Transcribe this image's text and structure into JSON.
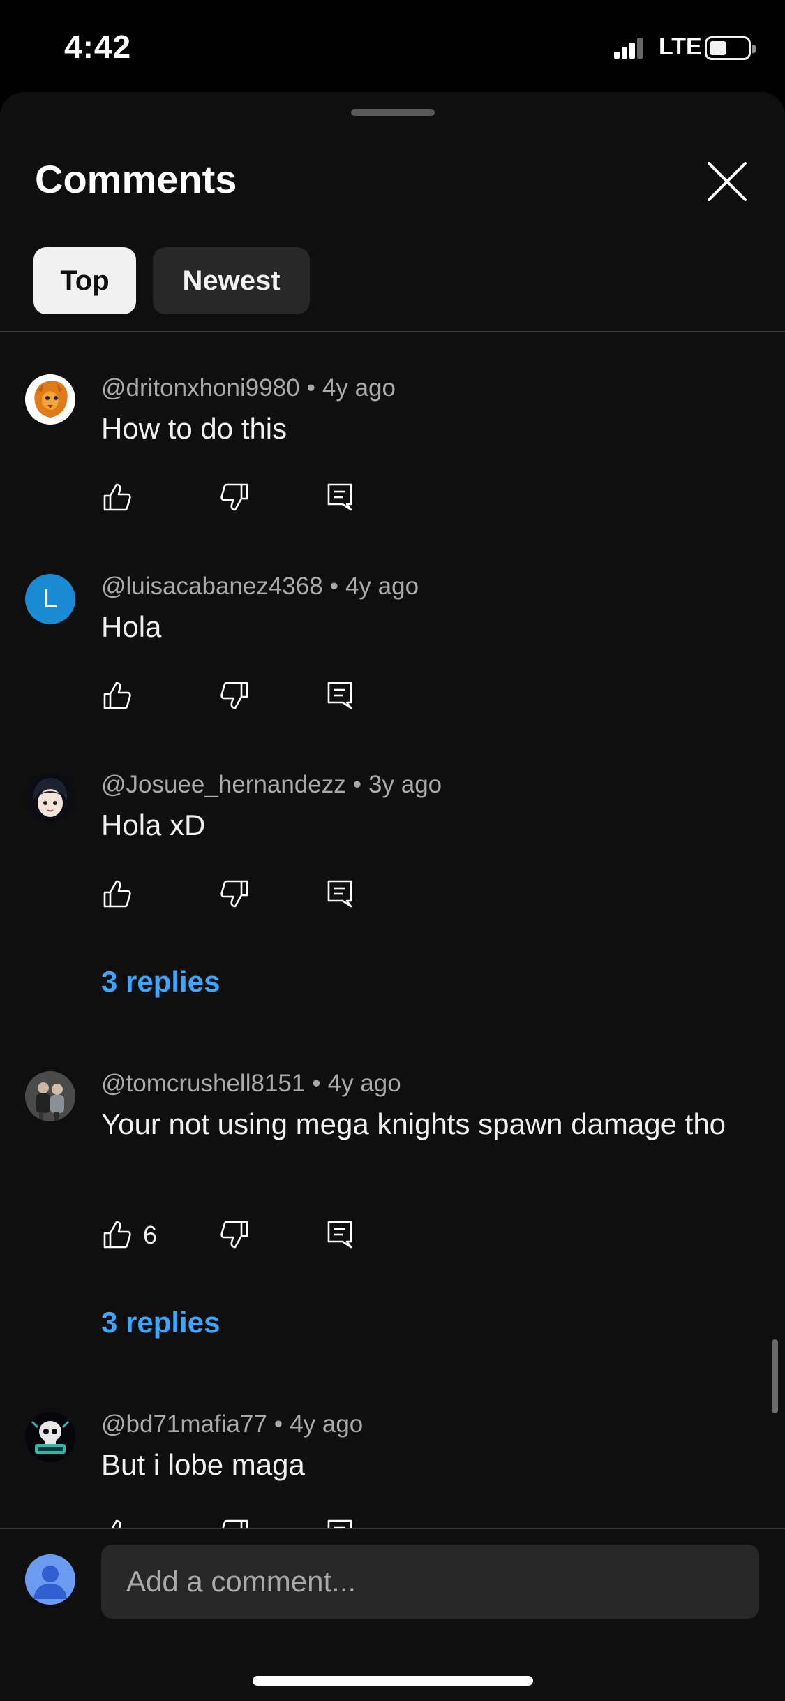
{
  "status_bar": {
    "time": "4:42",
    "network": "LTE",
    "icons": [
      "signal-icon",
      "battery-icon"
    ]
  },
  "sheet": {
    "title": "Comments",
    "close_icon": "close-icon",
    "filters": [
      {
        "label": "Top",
        "selected": true
      },
      {
        "label": "Newest",
        "selected": false
      }
    ]
  },
  "comments": [
    {
      "author": "@dritonxhoni9980",
      "time": "4y ago",
      "text": "How to do this",
      "likes": "",
      "replies": "",
      "avatar": "lion-logo-avatar"
    },
    {
      "author": "@luisacabanez4368",
      "time": "4y ago",
      "text": "Hola",
      "likes": "",
      "replies": "",
      "avatar": "letter-avatar",
      "avatar_letter": "L",
      "avatar_color": "#1a8ad4"
    },
    {
      "author": "@Josuee_hernandezz",
      "time": "3y ago",
      "text": "Hola xD",
      "likes": "",
      "replies": "3 replies",
      "avatar": "anime-avatar"
    },
    {
      "author": "@tomcrushell8151",
      "time": "4y ago",
      "text": "Your not using mega knights spawn damage tho",
      "likes": "6",
      "replies": "3 replies",
      "avatar": "photo-avatar"
    },
    {
      "author": "@bd71mafia77",
      "time": "4y ago",
      "text": "But i lobe maga",
      "likes": "",
      "replies": "",
      "avatar": "skull-logo-avatar"
    }
  ],
  "bottom": {
    "placeholder": "Add a comment..."
  },
  "colors": {
    "background": "#0f0f0f",
    "link": "#3ea6ff",
    "secondary_text": "#aaaaaa"
  }
}
